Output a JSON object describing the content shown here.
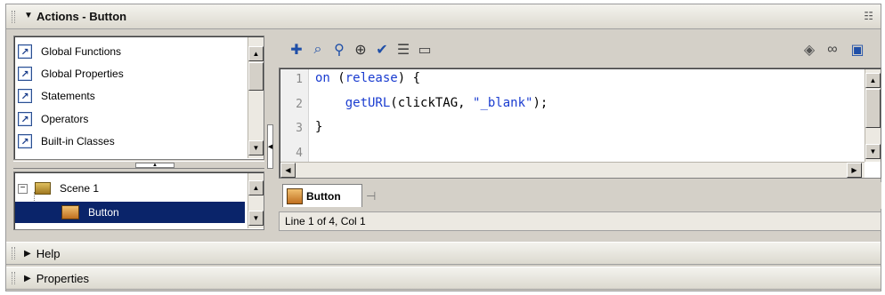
{
  "panel": {
    "title": "Actions - Button"
  },
  "toolbox": {
    "items": [
      {
        "label": "Global Functions",
        "icon": "book-icon"
      },
      {
        "label": "Global Properties",
        "icon": "book-icon"
      },
      {
        "label": "Statements",
        "icon": "book-icon"
      },
      {
        "label": "Operators",
        "icon": "book-icon"
      },
      {
        "label": "Built-in Classes",
        "icon": "book-icon"
      }
    ]
  },
  "script_navigator": {
    "items": [
      {
        "label": "Scene 1",
        "icon": "scene-icon",
        "expanded": true
      },
      {
        "label": "Button",
        "icon": "button-symbol-icon",
        "selected": true
      }
    ]
  },
  "editor": {
    "line_numbers": [
      "1",
      "2",
      "3",
      "4"
    ],
    "lines": [
      {
        "prefix": "",
        "keyword": "on",
        "rest": " (",
        "keyword2": "release",
        "tail": ") {"
      },
      {
        "prefix": "    ",
        "keyword": "getURL",
        "rest": "(clickTAG, ",
        "string": "\"_blank\"",
        "tail": ");"
      },
      {
        "prefix": "",
        "text": "}"
      },
      {
        "prefix": "",
        "text": ""
      }
    ]
  },
  "script_tab": {
    "label": "Button"
  },
  "status": {
    "text": "Line 1 of 4, Col 1"
  },
  "collapsed_panels": [
    {
      "label": "Help"
    },
    {
      "label": "Properties"
    }
  ],
  "colors": {
    "keyword": "#1a3cd0",
    "selection": "#0a246a",
    "panel_bg": "#d4d0c8"
  }
}
